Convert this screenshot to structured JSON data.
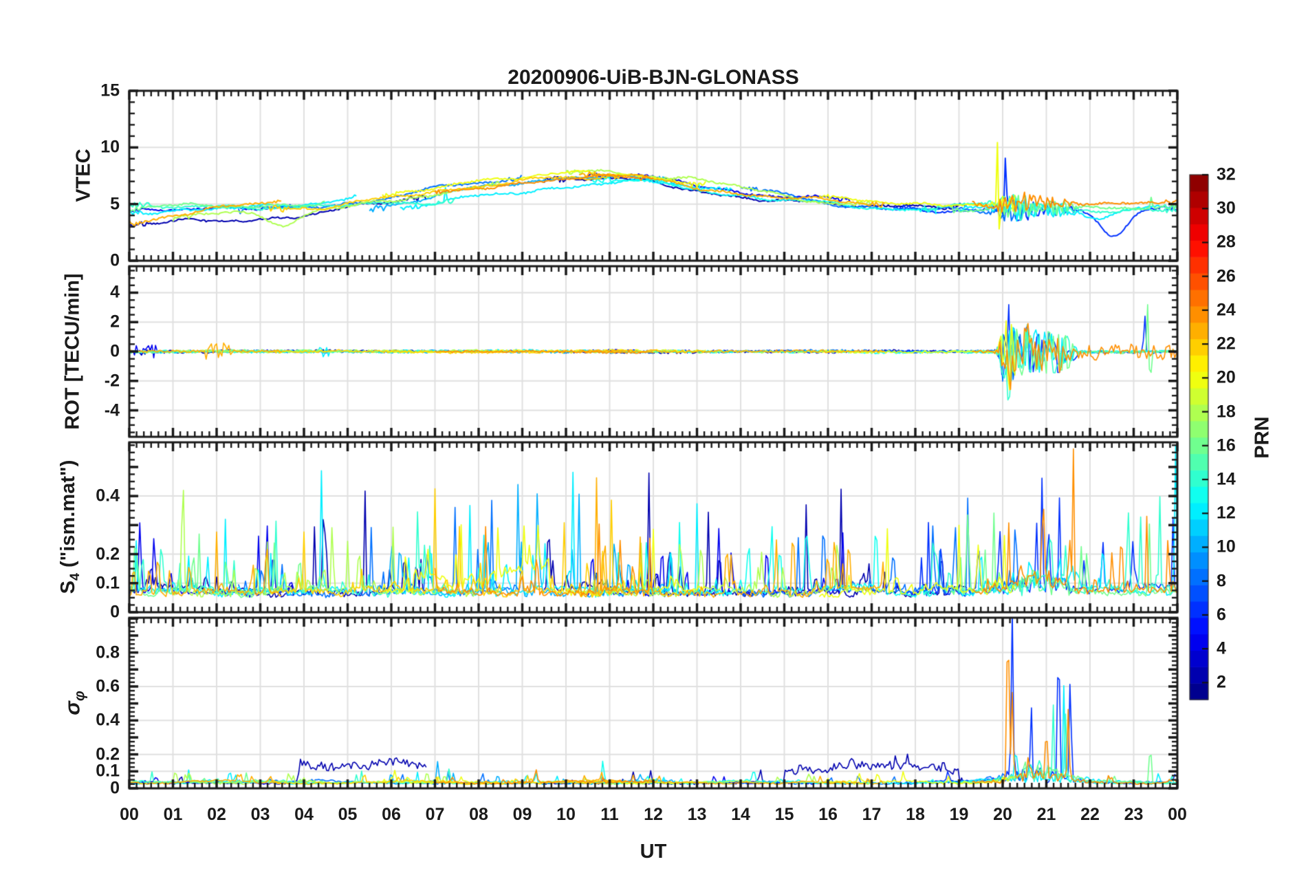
{
  "chart_data": {
    "type": "line",
    "title": "20200906-UiB-BJN-GLONASS",
    "xlabel": "UT",
    "x": {
      "range_hours": [
        0,
        24
      ],
      "tick_labels": [
        "00",
        "01",
        "02",
        "03",
        "04",
        "05",
        "06",
        "07",
        "08",
        "09",
        "10",
        "11",
        "12",
        "13",
        "14",
        "15",
        "16",
        "17",
        "18",
        "19",
        "20",
        "21",
        "22",
        "23",
        "00"
      ],
      "minor_per_hour": 6,
      "grid": "on"
    },
    "panels": [
      {
        "id": "vtec",
        "ylabel": "VTEC",
        "ymin": 0,
        "ymax": 15,
        "major_ticks": [
          0,
          5,
          10,
          15
        ],
        "minor_step": 1,
        "labeled_ticks": [
          0,
          5,
          10,
          15
        ],
        "tick_labels": [
          "0",
          "5",
          "10",
          "15"
        ],
        "grid": [
          5,
          10
        ]
      },
      {
        "id": "rot",
        "ylabel": "ROT [TECU/min]",
        "ymin": -5.8,
        "ymax": 5.8,
        "major_ticks": [
          -4,
          -2,
          0,
          2,
          4
        ],
        "minor_step": 0.5,
        "labeled_ticks": [
          -4,
          -2,
          0,
          2,
          4
        ],
        "tick_labels": [
          "-4",
          "-2",
          "0",
          "2",
          "4"
        ],
        "grid": [
          -4,
          -2,
          0,
          2,
          4
        ]
      },
      {
        "id": "s4",
        "ylabel_parts": {
          "main": "S",
          "sub": "4",
          "rest": " (\"ism.mat\")"
        },
        "ymin": 0,
        "ymax": 0.585,
        "major_ticks": [
          0,
          0.1,
          0.2,
          0.3,
          0.4,
          0.5
        ],
        "minor_step": 0.025,
        "labeled_ticks": [
          0,
          0.1,
          0.2,
          0.4
        ],
        "tick_labels": [
          "0",
          "0.1",
          "0.2",
          "0.4"
        ],
        "grid": [
          0.1,
          0.2,
          0.4
        ]
      },
      {
        "id": "sigma_phi",
        "ylabel_parts": {
          "main": "σ",
          "sub": "φ",
          "rest": ""
        },
        "ymin": 0,
        "ymax": 1.005,
        "major_ticks": [
          0,
          0.1,
          0.2,
          0.3,
          0.4,
          0.5,
          0.6,
          0.7,
          0.8,
          0.9,
          1.0
        ],
        "minor_step": 0.025,
        "labeled_ticks": [
          0,
          0.1,
          0.2,
          0.4,
          0.6,
          0.8
        ],
        "tick_labels": [
          "0",
          "0.1",
          "0.2",
          "0.4",
          "0.6",
          "0.8"
        ],
        "grid": [
          0.1,
          0.2,
          0.4,
          0.6,
          0.8
        ]
      }
    ],
    "colorbar": {
      "label": "PRN",
      "colormap": "jet",
      "n_colors": 32,
      "range": [
        1,
        32
      ],
      "ticks": [
        2,
        4,
        6,
        8,
        10,
        12,
        14,
        16,
        18,
        20,
        22,
        24,
        26,
        28,
        30,
        32
      ]
    },
    "colors": {
      "axis": "#1a1a1a",
      "grid": "#e0e0e0",
      "background": "#ffffff"
    },
    "model": {
      "vtec_base": {
        "level": 4.65,
        "bump": 2.95,
        "center": 10.6,
        "width": 4.35
      },
      "event_rot_bursts": [
        [
          20.1,
          0.14,
          3.3
        ],
        [
          20.5,
          0.3,
          1.9
        ],
        [
          21.05,
          0.3,
          1.4
        ],
        [
          21.45,
          0.22,
          1.1
        ]
      ],
      "event_vtec_noise": [
        [
          20.35,
          0.5,
          1.15
        ],
        [
          21.25,
          0.4,
          0.6
        ]
      ],
      "event_s4_extra": [
        [
          20.8,
          0.85,
          0.07
        ]
      ],
      "event_sigma_extra": [
        [
          20.8,
          0.85,
          0.09
        ]
      ]
    },
    "series": [
      {
        "prn": 2,
        "t0": 0.0,
        "t1": 6.8,
        "vtec_offset": [
          -1.7,
          -0.2
        ],
        "sigma_elevated": [
          [
            3.9,
            6.9,
            0.105
          ]
        ],
        "s4_spikes": [
          [
            0.5,
            0.15
          ],
          [
            4.25,
            0.3
          ],
          [
            5.4,
            0.33
          ],
          [
            6.3,
            0.25
          ]
        ],
        "rot_bursts": [
          [
            0.2,
            0.5,
            0.3
          ]
        ]
      },
      {
        "prn": 2,
        "t0": 9.5,
        "t1": 19.2,
        "vtec_offset": [
          -0.3,
          -0.2
        ],
        "sigma_elevated": [
          [
            15.0,
            19.0,
            0.1
          ]
        ],
        "s4_spikes": [
          [
            9.6,
            0.38
          ],
          [
            11.9,
            0.42
          ],
          [
            13.25,
            0.35
          ],
          [
            15.5,
            0.3
          ],
          [
            16.3,
            0.35
          ],
          [
            18.6,
            0.28
          ]
        ]
      },
      {
        "prn": 4,
        "t0": 0.0,
        "t1": 3.8,
        "vtec_offset": [
          -0.1,
          0.1
        ],
        "rot_bursts": [
          [
            0.1,
            0.6,
            0.55
          ]
        ],
        "s4_spikes": [
          [
            2.95,
            0.25
          ],
          [
            3.3,
            0.28
          ]
        ]
      },
      {
        "prn": 4,
        "t0": 10.5,
        "t1": 16.5,
        "vtec_offset": [
          0.1,
          0.0
        ],
        "s4_spikes": [
          [
            10.6,
            0.3
          ],
          [
            12.2,
            0.35
          ],
          [
            14.6,
            0.33
          ]
        ]
      },
      {
        "prn": 6,
        "t0": 17.5,
        "t1": 24.0,
        "evt": 1,
        "vtec_offset": [
          0.2,
          -0.4
        ],
        "vtec_spikes": [
          [
            20.07,
            5.6,
            0.025
          ],
          [
            22.55,
            -2.3,
            0.45
          ]
        ],
        "rot_spikes": [
          [
            23.25,
            2.8
          ]
        ],
        "s4_spikes": [
          [
            18.3,
            0.25
          ],
          [
            20.9,
            0.35
          ],
          [
            21.3,
            0.3
          ],
          [
            23.9,
            0.25
          ]
        ],
        "sigma_spikes": [
          [
            20.22,
            1.0,
            0.03
          ],
          [
            20.65,
            0.48,
            0.025
          ],
          [
            21.28,
            0.9,
            0.03
          ],
          [
            21.55,
            0.62,
            0.03
          ]
        ]
      },
      {
        "prn": 8,
        "t0": 2.5,
        "t1": 9.0,
        "vtec_offset": [
          -0.4,
          0.0
        ],
        "s4_spikes": [
          [
            5.55,
            0.28
          ],
          [
            7.45,
            0.35
          ],
          [
            8.3,
            0.3
          ]
        ]
      },
      {
        "prn": 8,
        "t0": 14.0,
        "t1": 20.5,
        "evt": 1,
        "vtec_offset": [
          0.0,
          -0.3
        ],
        "s4_spikes": [
          [
            15.9,
            0.3
          ],
          [
            17.5,
            0.28
          ],
          [
            19.2,
            0.33
          ],
          [
            20.3,
            0.3
          ]
        ]
      },
      {
        "prn": 10,
        "t0": 5.5,
        "t1": 12.5,
        "vtec_offset": [
          -0.5,
          -0.2
        ],
        "s4_spikes": [
          [
            6.2,
            0.3
          ],
          [
            8.9,
            0.38
          ],
          [
            9.35,
            0.42
          ],
          [
            10.3,
            0.25
          ],
          [
            12.4,
            0.3
          ]
        ]
      },
      {
        "prn": 12,
        "t0": 0.0,
        "t1": 5.2,
        "vtec_offset": [
          0.0,
          -0.2
        ],
        "rot_bursts": [
          [
            4.3,
            4.6,
            0.35
          ]
        ],
        "s4_spikes": [
          [
            0.15,
            0.2
          ],
          [
            2.2,
            0.25
          ],
          [
            4.4,
            0.3
          ]
        ]
      },
      {
        "prn": 12,
        "t0": 6.2,
        "t1": 13.8,
        "vtec_offset": [
          -1.0,
          -0.3
        ],
        "vtec_spikes": [
          [
            7.25,
            1.4,
            0.02
          ],
          [
            13.05,
            0.9,
            0.012
          ],
          [
            13.09,
            -0.8,
            0.012
          ]
        ],
        "s4_spikes": [
          [
            6.9,
            0.35
          ],
          [
            7.8,
            0.3
          ],
          [
            10.15,
            0.45
          ],
          [
            13.0,
            0.3
          ]
        ]
      },
      {
        "prn": 12,
        "t0": 19.0,
        "t1": 24.0,
        "evt": 1,
        "vtec_offset": [
          -0.2,
          -0.3
        ],
        "vtec_spikes": [
          [
            22.2,
            -1.0,
            0.5
          ]
        ],
        "s4_spikes": [
          [
            19.5,
            0.3
          ],
          [
            22.3,
            0.28
          ],
          [
            23.95,
            0.45
          ]
        ],
        "sigma_spikes": [
          [
            20.3,
            0.3,
            0.02
          ],
          [
            21.4,
            0.52,
            0.025
          ]
        ]
      },
      {
        "prn": 13,
        "t0": 10.6,
        "t1": 18.5,
        "vtec_offset": [
          -0.7,
          -0.4
        ],
        "s4_spikes": [
          [
            12.6,
            0.25
          ],
          [
            14.9,
            0.3
          ],
          [
            17.1,
            0.46
          ]
        ],
        "sigma_spikes": [
          [
            10.85,
            0.14,
            0.03
          ]
        ]
      },
      {
        "prn": 14,
        "t0": 0.0,
        "t1": 7.5,
        "vtec_offset": [
          0.2,
          -0.6
        ],
        "s4_spikes": [
          [
            0.3,
            0.22
          ],
          [
            3.35,
            0.3
          ],
          [
            6.6,
            0.26
          ]
        ]
      },
      {
        "prn": 14,
        "t0": 18.2,
        "t1": 24.0,
        "evt": 1,
        "vtec_offset": [
          -0.2,
          -0.1
        ],
        "s4_spikes": [
          [
            21.1,
            0.3
          ],
          [
            23.6,
            0.3
          ]
        ],
        "sigma_spikes": [
          [
            21.15,
            0.5,
            0.02
          ],
          [
            21.45,
            0.42,
            0.02
          ]
        ]
      },
      {
        "prn": 16,
        "t0": 0.0,
        "t1": 4.5,
        "vtec_offset": [
          0.3,
          0.1
        ],
        "s4_spikes": [
          [
            1.6,
            0.2
          ],
          [
            3.9,
            0.22
          ]
        ]
      },
      {
        "prn": 16,
        "t0": 18.8,
        "t1": 24.0,
        "evt": 1,
        "vtec_offset": [
          -0.1,
          -0.3
        ],
        "vtec_spikes": [
          [
            23.4,
            0.9,
            0.03
          ]
        ],
        "rot_spikes": [
          [
            23.32,
            3.2
          ],
          [
            23.38,
            -2.6
          ]
        ],
        "s4_spikes": [
          [
            19.8,
            0.25
          ],
          [
            23.35,
            0.3
          ]
        ],
        "sigma_spikes": [
          [
            20.5,
            0.2,
            0.02
          ],
          [
            23.38,
            0.44,
            0.02
          ]
        ]
      },
      {
        "prn": 18,
        "t0": 1.0,
        "t1": 8.5,
        "vtec_offset": [
          -0.8,
          -0.3
        ],
        "vtec_spikes": [
          [
            3.5,
            -1.5,
            0.45
          ]
        ],
        "s4_spikes": [
          [
            1.22,
            0.44
          ],
          [
            2.9,
            0.22
          ],
          [
            5.0,
            0.18
          ]
        ]
      },
      {
        "prn": 18,
        "t0": 10.0,
        "t1": 17.0,
        "vtec_offset": [
          0.3,
          0.2
        ],
        "s4_spikes": [
          [
            13.1,
            0.3
          ],
          [
            16.1,
            0.2
          ]
        ]
      },
      {
        "prn": 20,
        "t0": 5.8,
        "t1": 13.2,
        "vtec_offset": [
          0.4,
          0.3
        ],
        "s4_elevated": [
          [
            6.5,
            9.6,
            0.09
          ]
        ],
        "s4_spikes": [
          [
            7.6,
            0.2
          ],
          [
            8.45,
            0.22
          ],
          [
            9.05,
            0.18
          ],
          [
            12.0,
            0.2
          ]
        ]
      },
      {
        "prn": 20,
        "t0": 15.8,
        "t1": 20.3,
        "evt": 1,
        "vtec_offset": [
          0.3,
          0.2
        ],
        "vtec_spikes": [
          [
            19.88,
            5.0,
            0.018
          ],
          [
            19.93,
            -3.4,
            0.018
          ]
        ],
        "s4_spikes": [
          [
            17.35,
            0.28
          ],
          [
            19.0,
            0.22
          ],
          [
            20.05,
            0.25
          ]
        ]
      },
      {
        "prn": 22,
        "t0": 3.2,
        "t1": 11.3,
        "vtec_offset": [
          -0.2,
          0.2
        ],
        "s4_spikes": [
          [
            4.0,
            0.2
          ],
          [
            7.0,
            0.35
          ],
          [
            9.95,
            0.3
          ],
          [
            11.05,
            0.4
          ]
        ]
      },
      {
        "prn": 23,
        "t0": 0.0,
        "t1": 3.5,
        "vtec_offset": [
          -1.1,
          0.3
        ],
        "rot_bursts": [
          [
            1.75,
            2.35,
            0.6
          ]
        ],
        "s4_spikes": [
          [
            0.1,
            0.18
          ],
          [
            2.0,
            0.2
          ]
        ]
      },
      {
        "prn": 23,
        "t0": 10.3,
        "t1": 17.3,
        "vtec_offset": [
          0.0,
          0.1
        ],
        "s4_spikes": [
          [
            10.7,
            0.4
          ],
          [
            15.2,
            0.44
          ],
          [
            16.0,
            0.25
          ]
        ]
      },
      {
        "prn": 24,
        "t0": 7.0,
        "t1": 12.0,
        "vtec_offset": [
          -0.3,
          0.2
        ],
        "s4_spikes": [
          [
            8.15,
            0.3
          ],
          [
            10.75,
            0.3
          ]
        ]
      },
      {
        "prn": 24,
        "t0": 19.3,
        "t1": 24.0,
        "evt": 1,
        "vtec_offset": [
          0.2,
          0.3
        ],
        "rot_bursts": [
          [
            21.7,
            24.0,
            0.5
          ]
        ],
        "s4_spikes": [
          [
            20.15,
            0.3
          ],
          [
            21.62,
            0.46
          ],
          [
            22.72,
            0.42
          ],
          [
            23.3,
            0.25
          ]
        ],
        "sigma_spikes": [
          [
            20.12,
            0.95,
            0.035
          ],
          [
            20.22,
            0.5,
            0.03
          ],
          [
            21.0,
            0.4,
            0.025
          ],
          [
            21.5,
            0.42,
            0.03
          ]
        ]
      }
    ]
  }
}
